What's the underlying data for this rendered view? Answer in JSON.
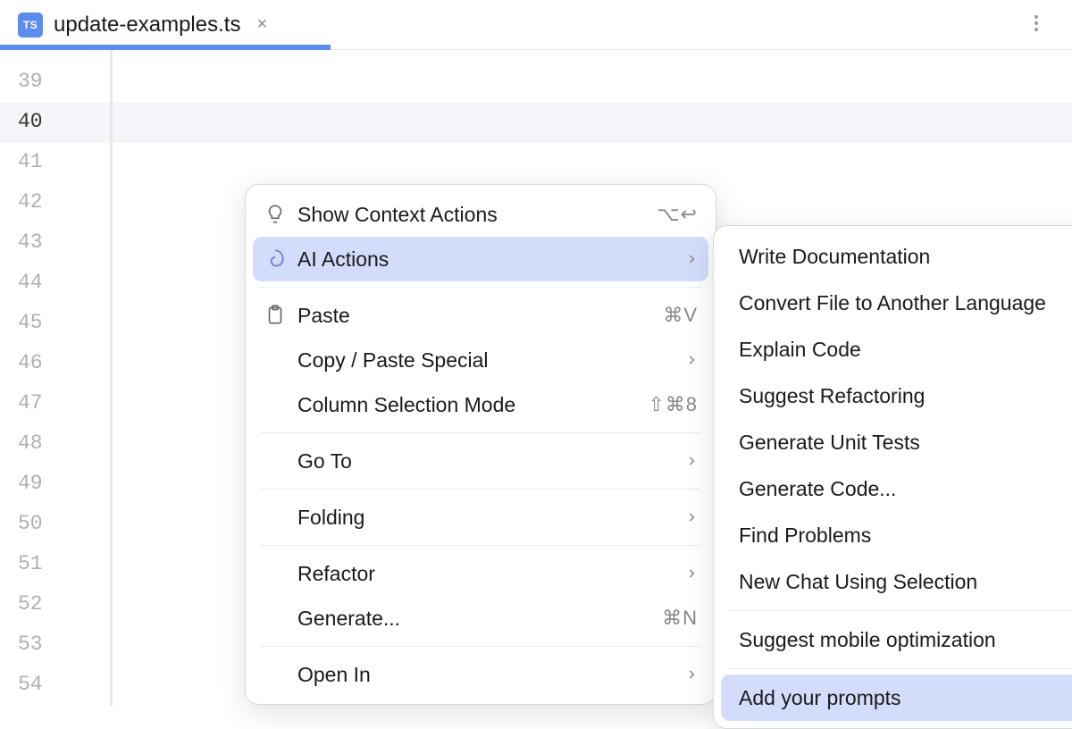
{
  "tab": {
    "icon_label": "TS",
    "filename": "update-examples.ts"
  },
  "gutter": {
    "lines": [
      39,
      40,
      41,
      42,
      43,
      44,
      45,
      46,
      47,
      48,
      49,
      50,
      51,
      52,
      53,
      54
    ],
    "current_line": 40
  },
  "context_menu": {
    "items": [
      {
        "label": "Show Context Actions",
        "shortcut": "⌥↩",
        "icon": "lightbulb"
      },
      {
        "label": "AI Actions",
        "icon": "ai-spiral",
        "chevron": true,
        "highlighted": true
      },
      {
        "separator": true
      },
      {
        "label": "Paste",
        "shortcut": "⌘V",
        "icon": "clipboard"
      },
      {
        "label": "Copy / Paste Special",
        "chevron": true
      },
      {
        "label": "Column Selection Mode",
        "shortcut": "⇧⌘8"
      },
      {
        "separator": true
      },
      {
        "label": "Go To",
        "chevron": true
      },
      {
        "separator": true
      },
      {
        "label": "Folding",
        "chevron": true
      },
      {
        "separator": true
      },
      {
        "label": "Refactor",
        "chevron": true
      },
      {
        "label": "Generate...",
        "shortcut": "⌘N"
      },
      {
        "separator": true
      },
      {
        "label": "Open In",
        "chevron": true
      }
    ]
  },
  "submenu": {
    "items": [
      {
        "label": "Write Documentation"
      },
      {
        "label": "Convert File to Another Language"
      },
      {
        "label": "Explain Code"
      },
      {
        "label": "Suggest Refactoring"
      },
      {
        "label": "Generate Unit Tests"
      },
      {
        "label": "Generate Code..."
      },
      {
        "label": "Find Problems"
      },
      {
        "label": "New Chat Using Selection"
      },
      {
        "separator": true
      },
      {
        "label": "Suggest mobile optimization"
      },
      {
        "separator": true
      },
      {
        "label": "Add your prompts",
        "highlighted": true
      }
    ]
  }
}
